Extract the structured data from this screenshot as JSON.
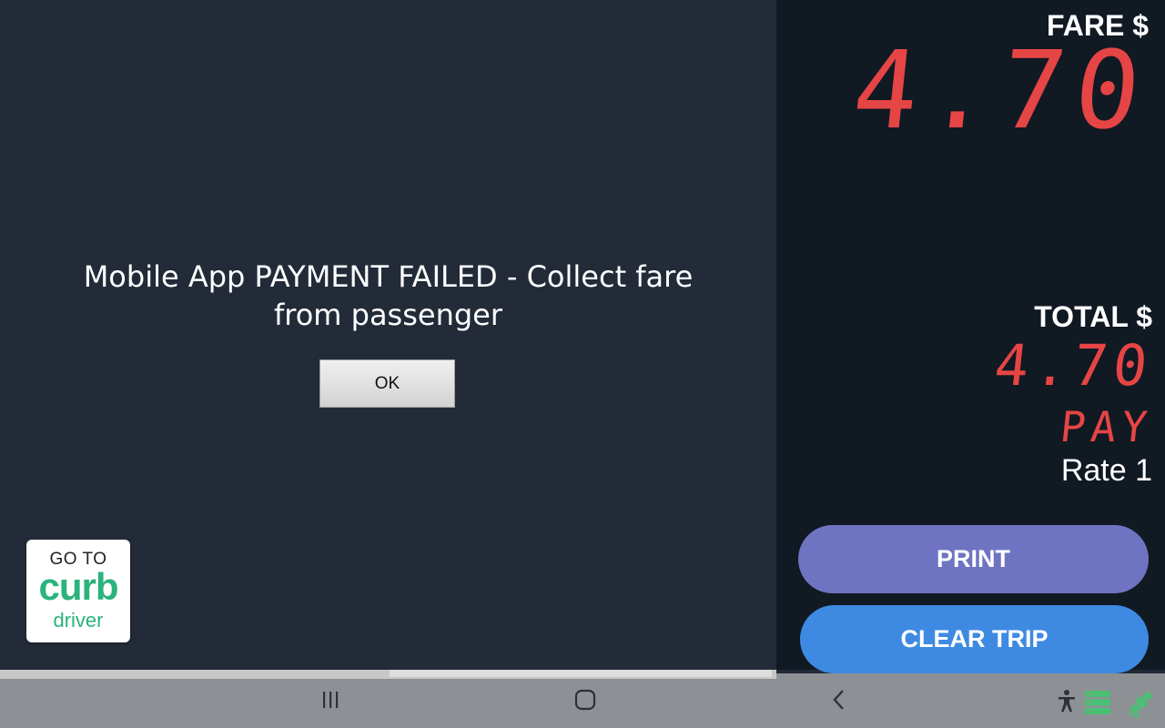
{
  "dialog": {
    "message": "Mobile App PAYMENT FAILED - Collect fare from passenger",
    "ok_label": "OK"
  },
  "curb": {
    "goto": "GO TO",
    "logo": "curb",
    "driver": "driver"
  },
  "meter": {
    "fare_label": "FARE $",
    "fare_value": "4.70",
    "total_label": "TOTAL $",
    "total_value": "4.70",
    "status": "PAY",
    "rate": "Rate 1"
  },
  "actions": {
    "print_label": "PRINT",
    "clear_label": "CLEAR TRIP"
  },
  "colors": {
    "meter_digits": "#e64545",
    "print_button": "#6f74c2",
    "clear_button": "#3e8ae3",
    "curb_green": "#2ab37c"
  },
  "nav": {
    "icons": [
      "recent-apps-icon",
      "home-icon",
      "back-icon"
    ],
    "status_icons": [
      "accessibility-icon",
      "server-icon",
      "satellite-icon"
    ]
  }
}
